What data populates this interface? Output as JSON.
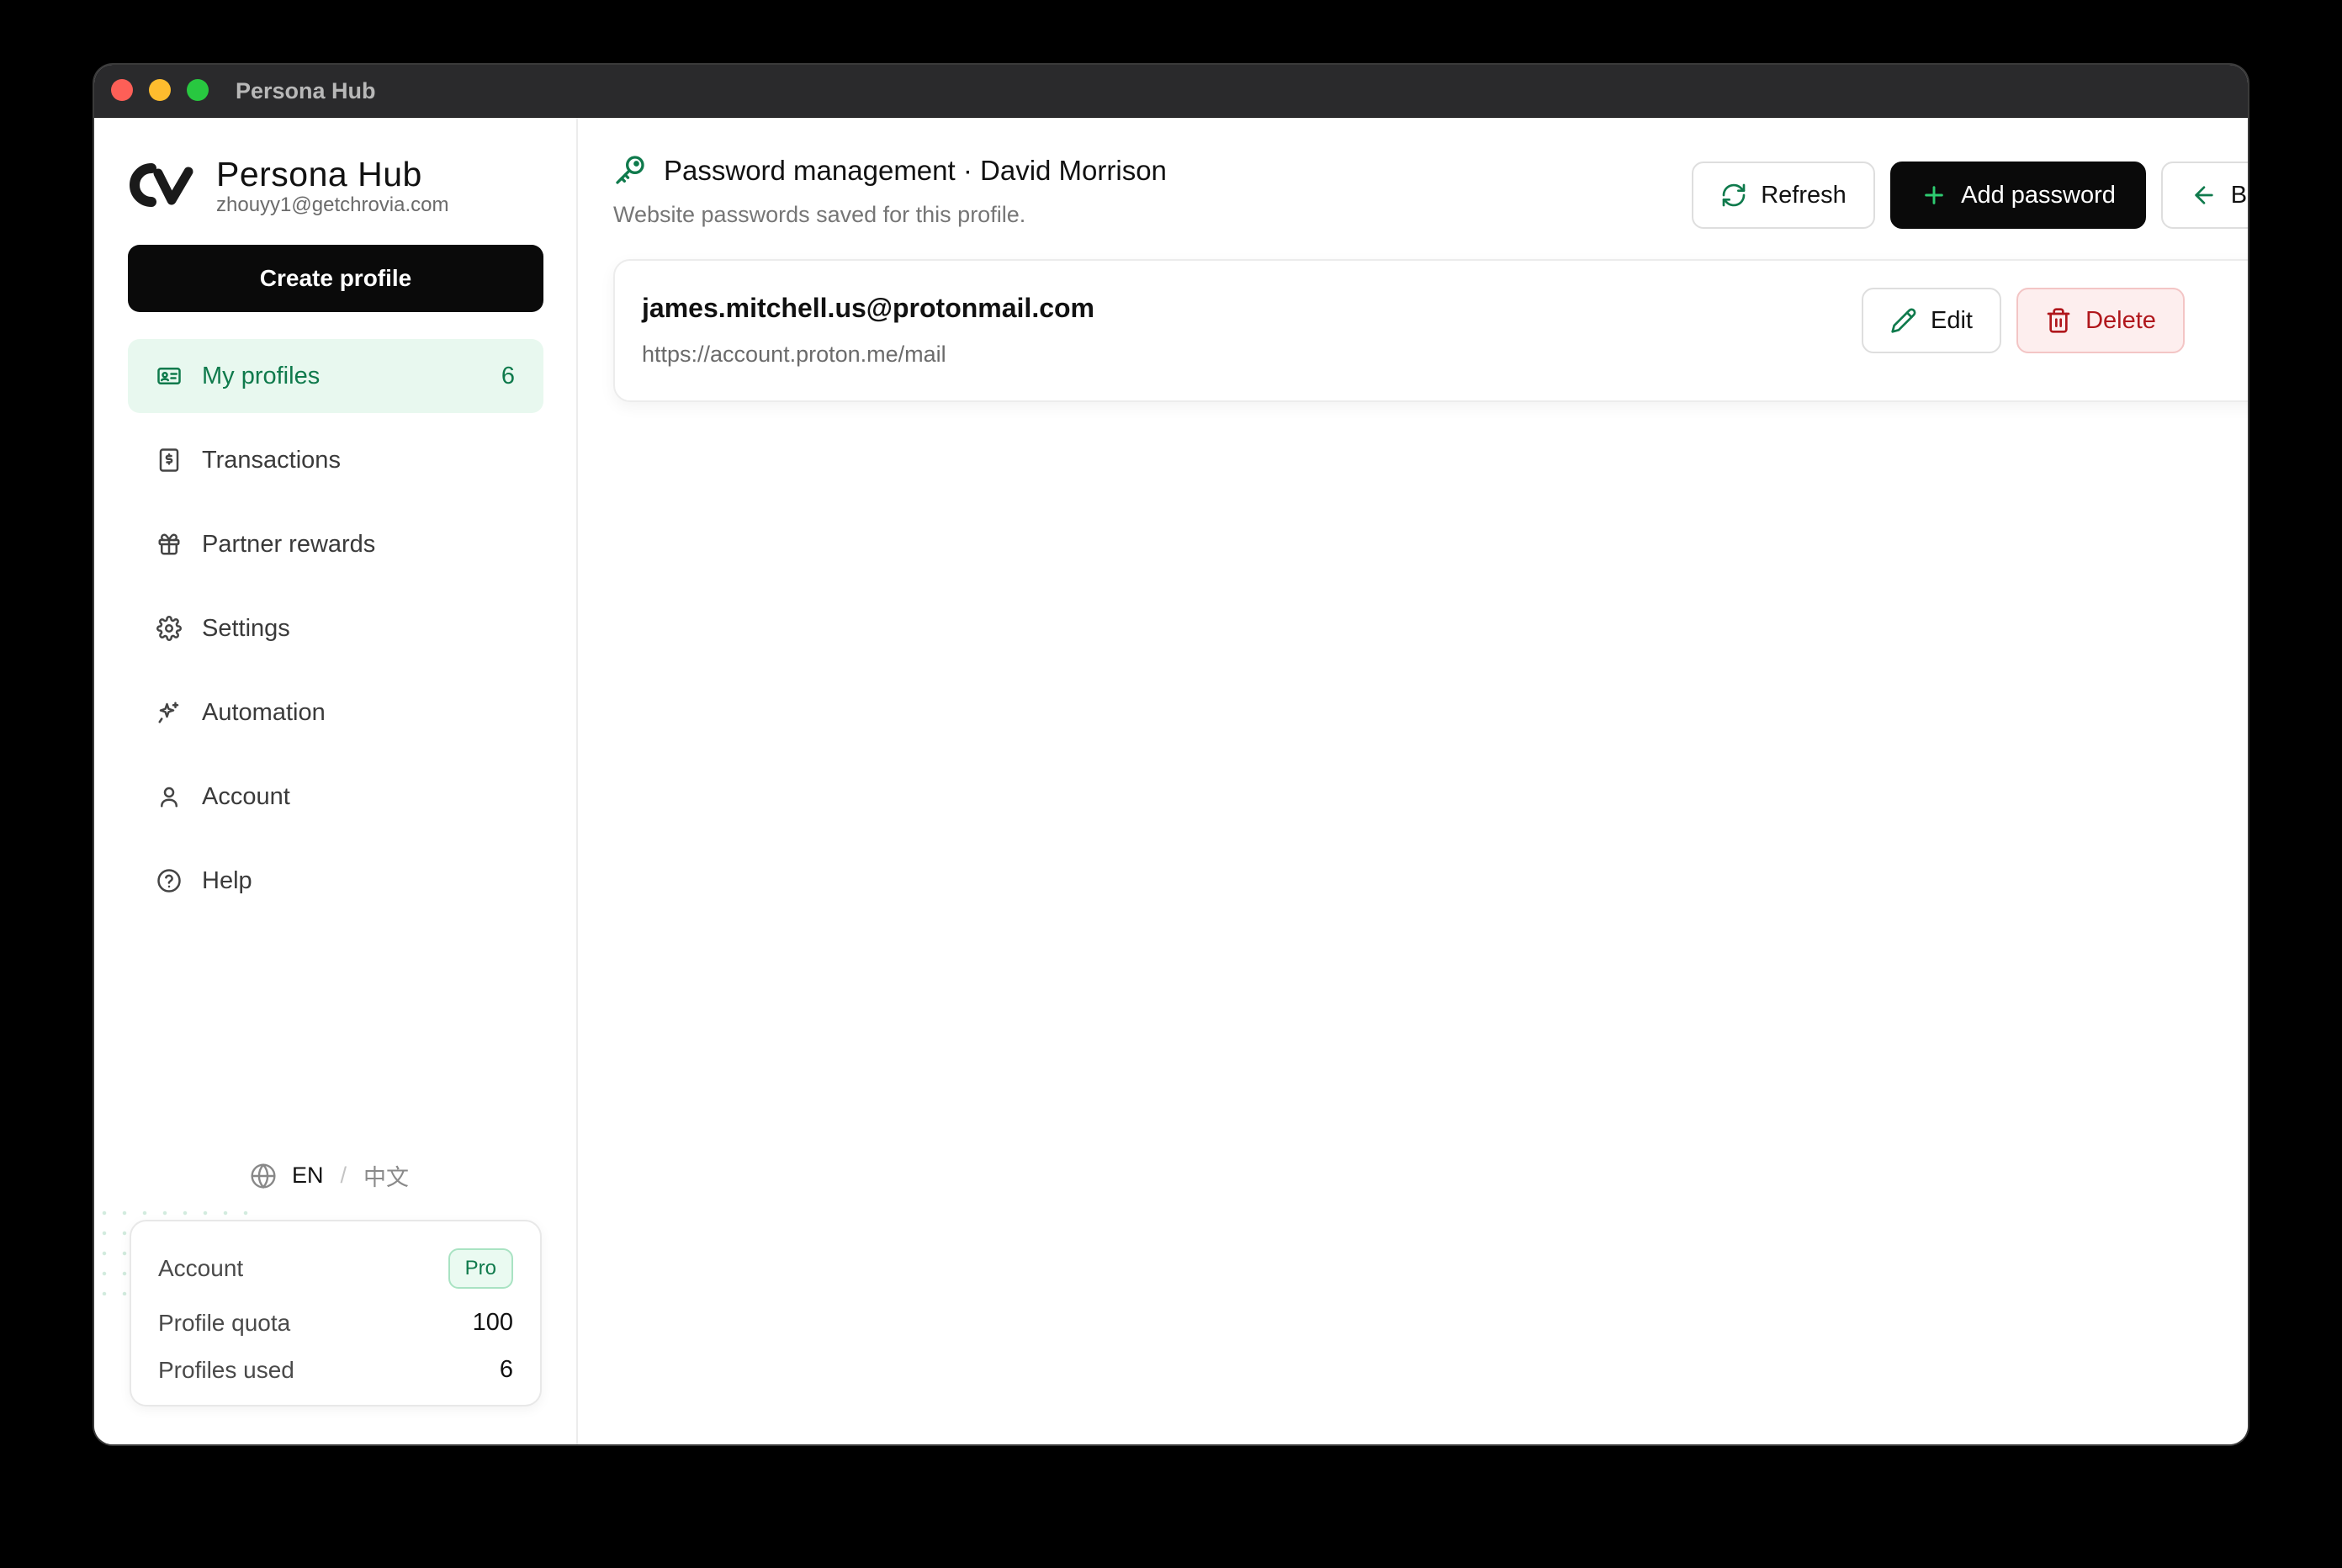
{
  "window": {
    "title": "Persona Hub"
  },
  "brand": {
    "name": "Persona Hub",
    "email": "zhouyy1@getchrovia.com"
  },
  "sidebar": {
    "create_label": "Create profile",
    "items": [
      {
        "label": "My profiles",
        "icon": "id-card-icon",
        "count": "6",
        "active": true
      },
      {
        "label": "Transactions",
        "icon": "receipt-icon"
      },
      {
        "label": "Partner rewards",
        "icon": "gift-icon"
      },
      {
        "label": "Settings",
        "icon": "gear-icon"
      },
      {
        "label": "Automation",
        "icon": "sparkles-icon"
      },
      {
        "label": "Account",
        "icon": "user-icon"
      },
      {
        "label": "Help",
        "icon": "help-circle-icon"
      }
    ],
    "language": {
      "current": "EN",
      "separator": "/",
      "other": "中文"
    },
    "account_card": {
      "account_label": "Account",
      "plan": "Pro",
      "quota_label": "Profile quota",
      "quota_value": "100",
      "used_label": "Profiles used",
      "used_value": "6"
    }
  },
  "main": {
    "title": "Password management · David Morrison",
    "subtitle": "Website passwords saved for this profile.",
    "refresh_label": "Refresh",
    "add_label": "Add password",
    "back_label": "Back",
    "passwords": [
      {
        "email": "james.mitchell.us@protonmail.com",
        "url": "https://account.proton.me/mail",
        "edit_label": "Edit",
        "delete_label": "Delete"
      }
    ]
  },
  "colors": {
    "accent_green": "#0f7a4c",
    "active_bg": "#e8f8ef",
    "danger": "#b0171c",
    "danger_bg": "#fdeeee",
    "primary_button": "#0a0a0a"
  }
}
